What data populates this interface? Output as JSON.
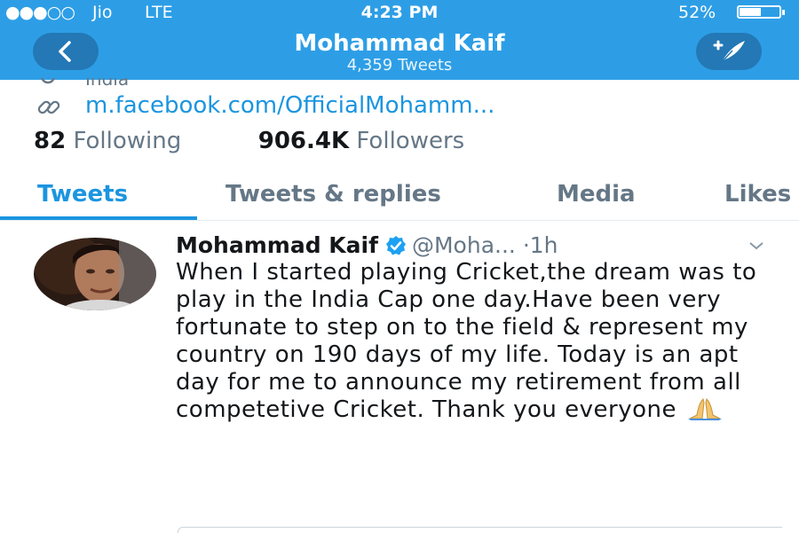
{
  "status_bar": {
    "signal": "●●●○○",
    "carrier": "Jio",
    "network": "LTE",
    "time": "4:23 PM",
    "battery_percent": "52%",
    "battery_level": 0.52
  },
  "header": {
    "title": "Mohammad Kaif",
    "subtitle": "4,359 Tweets",
    "back_icon": "chevron-left-icon",
    "compose_icon": "compose-tweet-icon",
    "color": "#2d9ee6"
  },
  "profile": {
    "location": "India",
    "link": "m.facebook.com/OfficialMohamm...",
    "following_count": "82",
    "following_label": "Following",
    "followers_count": "906.4K",
    "followers_label": "Followers"
  },
  "tabs": [
    {
      "label": "Tweets",
      "active": true
    },
    {
      "label": "Tweets & replies",
      "active": false
    },
    {
      "label": "Media",
      "active": false
    },
    {
      "label": "Likes",
      "active": false
    }
  ],
  "tweet": {
    "name": "Mohammad Kaif",
    "handle": "@Moha...",
    "separator": "·",
    "age": "1h",
    "verified": true,
    "text": "When I started playing Cricket,the dream was to play in the India Cap one day.Have been very fortunate to step on to the field & represent my country on 190 days of my life. Today is an apt day for me to announce my retirement from all competetive Cricket. Thank you everyone"
  },
  "colors": {
    "accent": "#1b95e0",
    "muted": "#657786",
    "text": "#14171a"
  }
}
